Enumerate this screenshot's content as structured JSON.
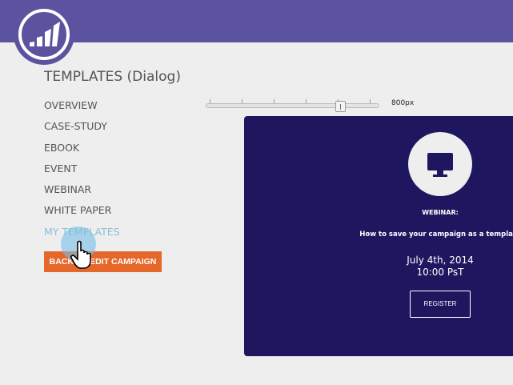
{
  "header": {
    "brand_color": "#5c53a0",
    "logo": "marketo-logo"
  },
  "page": {
    "title": "TEMPLATES (Dialog)"
  },
  "nav": {
    "items": [
      {
        "label": "OVERVIEW"
      },
      {
        "label": "CASE-STUDY"
      },
      {
        "label": "EBOOK"
      },
      {
        "label": "EVENT"
      },
      {
        "label": "WEBINAR"
      },
      {
        "label": "WHITE PAPER"
      },
      {
        "label": "MY TEMPLATES",
        "hovered": true
      }
    ]
  },
  "back_button": {
    "label": "BACK TO EDIT CAMPAIGN",
    "color": "#e5682a"
  },
  "slider": {
    "value_label": "800px",
    "position_percent": 78
  },
  "card": {
    "icon": "monitor-icon",
    "type": "WEBINAR:",
    "headline": "How to save your campaign as a template",
    "date": "July 4th, 2014",
    "time": "10:00 PsT",
    "register_label": "REGISTER",
    "bg_color": "#1e1760"
  }
}
